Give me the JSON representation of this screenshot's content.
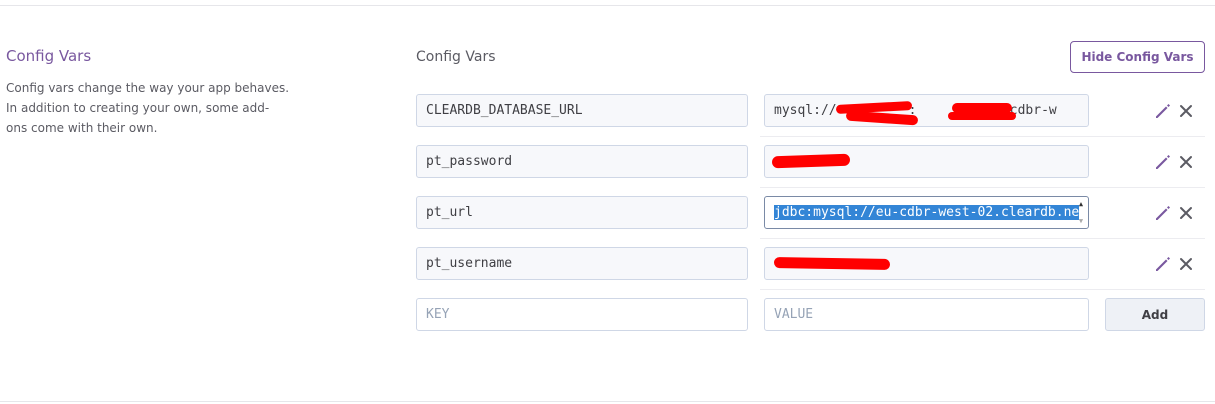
{
  "section": {
    "title": "Config Vars",
    "description_lines": [
      "Config vars change the way your app behaves.",
      "In addition to creating your own, some add-",
      "ons come with their own."
    ]
  },
  "panel": {
    "title": "Config Vars",
    "hide_button": "Hide Config Vars"
  },
  "rows": [
    {
      "key": "CLEARDB_DATABASE_URL",
      "value_prefix": "mysql://",
      "value_mid": ":",
      "value_suffix": "@eu-cdbr-w"
    },
    {
      "key": "pt_password",
      "value": ""
    },
    {
      "key": "pt_url",
      "value": "jdbc:mysql://eu-cdbr-west-02.cleardb.ne"
    },
    {
      "key": "pt_username",
      "value": ""
    }
  ],
  "new_row": {
    "key_placeholder": "KEY",
    "value_placeholder": "VALUE",
    "add_button": "Add"
  },
  "colors": {
    "accent": "#79589f",
    "selection": "#3385d6",
    "redaction": "#ff0000"
  },
  "icons": {
    "edit": "pencil-icon",
    "delete": "close-icon"
  }
}
